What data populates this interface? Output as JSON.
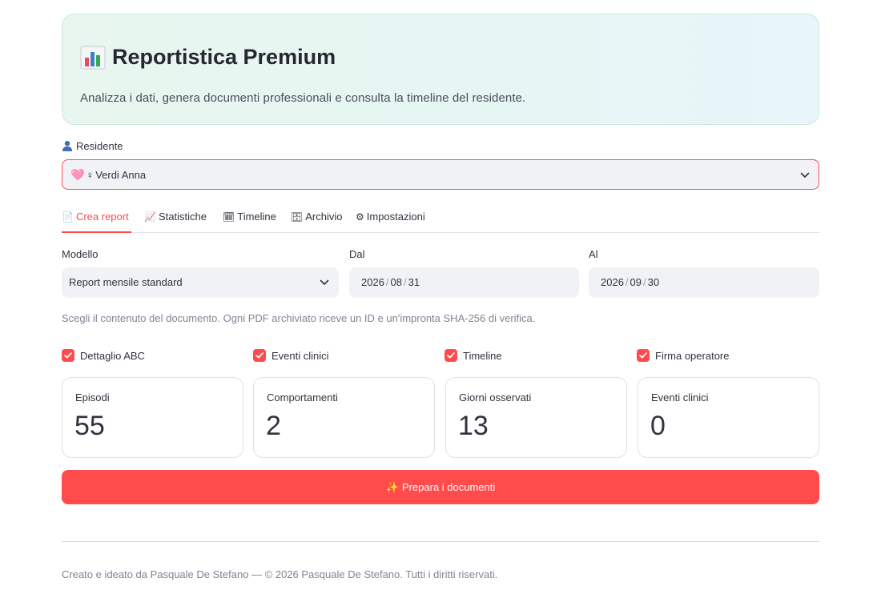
{
  "header": {
    "icon": "bar-chart-icon",
    "title": "Reportistica Premium",
    "subtitle": "Analizza i dati, genera documenti professionali e consulta la timeline del residente."
  },
  "resident": {
    "label_icon": "person-icon",
    "label": "Residente",
    "selected_heart": "🩷",
    "selected_gender": "♀",
    "selected_name": "Verdi Anna"
  },
  "tabs": [
    {
      "icon": "📄",
      "label": "Crea report",
      "active": true
    },
    {
      "icon": "📈",
      "label": "Statistiche",
      "active": false
    },
    {
      "icon": "🗓",
      "label": "Timeline",
      "active": false
    },
    {
      "icon": "🗄",
      "label": "Archivio",
      "active": false
    },
    {
      "icon": "⚙",
      "label": "Impostazioni",
      "active": false
    }
  ],
  "form": {
    "model_label": "Modello",
    "model_value": "Report mensile standard",
    "from_label": "Dal",
    "from_date": {
      "y": "2026",
      "m": "08",
      "d": "31"
    },
    "to_label": "Al",
    "to_date": {
      "y": "2026",
      "m": "09",
      "d": "30"
    },
    "help_text": "Scegli il contenuto del documento. Ogni PDF archiviato riceve un ID e un'impronta SHA-256 di verifica.",
    "date_sep": "/"
  },
  "options": [
    {
      "label": "Dettaglio ABC",
      "checked": true
    },
    {
      "label": "Eventi clinici",
      "checked": true
    },
    {
      "label": "Timeline",
      "checked": true
    },
    {
      "label": "Firma operatore",
      "checked": true
    }
  ],
  "metrics": [
    {
      "label": "Episodi",
      "value": "55"
    },
    {
      "label": "Comportamenti",
      "value": "2"
    },
    {
      "label": "Giorni osservati",
      "value": "13"
    },
    {
      "label": "Eventi clinici",
      "value": "0"
    }
  ],
  "action": {
    "icon": "✨",
    "label": "Prepara i documenti"
  },
  "footer": {
    "text": "Creato e ideato da Pasquale De Stefano — © 2026 Pasquale De Stefano. Tutti i diritti riservati."
  },
  "colors": {
    "accent": "#ff4b4b",
    "field_bg": "#f0f2f6",
    "hero_gradient_start": "#e8f6ef",
    "hero_gradient_end": "#e8f5fa"
  }
}
